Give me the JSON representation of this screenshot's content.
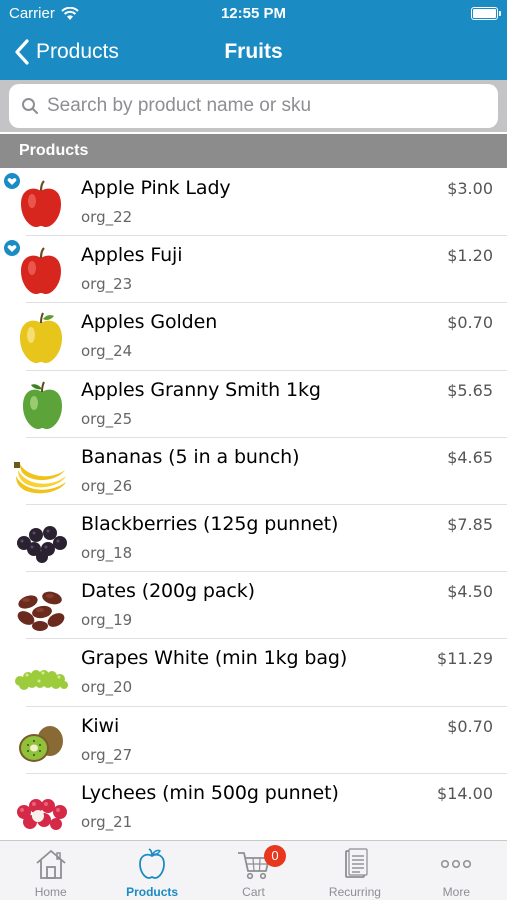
{
  "status_bar": {
    "carrier": "Carrier",
    "time": "12:55 PM"
  },
  "nav": {
    "back_label": "Products",
    "title": "Fruits"
  },
  "search": {
    "placeholder": "Search by product name or sku",
    "value": ""
  },
  "section": {
    "title": "Products"
  },
  "products": [
    {
      "name": "Apple Pink Lady",
      "sku": "org_22",
      "price": "$3.00",
      "favorite": true,
      "icon": "red-apple-icon"
    },
    {
      "name": "Apples Fuji",
      "sku": "org_23",
      "price": "$1.20",
      "favorite": true,
      "icon": "red-apple-icon"
    },
    {
      "name": "Apples Golden",
      "sku": "org_24",
      "price": "$0.70",
      "favorite": false,
      "icon": "yellow-apple-icon"
    },
    {
      "name": "Apples Granny Smith 1kg",
      "sku": "org_25",
      "price": "$5.65",
      "favorite": false,
      "icon": "green-apple-icon"
    },
    {
      "name": "Bananas (5 in a bunch)",
      "sku": "org_26",
      "price": "$4.65",
      "favorite": false,
      "icon": "banana-icon"
    },
    {
      "name": "Blackberries (125g punnet)",
      "sku": "org_18",
      "price": "$7.85",
      "favorite": false,
      "icon": "blackberries-icon"
    },
    {
      "name": "Dates (200g pack)",
      "sku": "org_19",
      "price": "$4.50",
      "favorite": false,
      "icon": "dates-icon"
    },
    {
      "name": "Grapes White (min 1kg bag)",
      "sku": "org_20",
      "price": "$11.29",
      "favorite": false,
      "icon": "grapes-icon"
    },
    {
      "name": "Kiwi",
      "sku": "org_27",
      "price": "$0.70",
      "favorite": false,
      "icon": "kiwi-icon"
    },
    {
      "name": "Lychees (min 500g punnet)",
      "sku": "org_21",
      "price": "$14.00",
      "favorite": false,
      "icon": "lychees-icon"
    }
  ],
  "tabs": [
    {
      "label": "Home",
      "icon": "home-icon",
      "active": false
    },
    {
      "label": "Products",
      "icon": "apple-icon",
      "active": true
    },
    {
      "label": "Cart",
      "icon": "cart-icon",
      "active": false,
      "badge": "0"
    },
    {
      "label": "Recurring",
      "icon": "recurring-icon",
      "active": false
    },
    {
      "label": "More",
      "icon": "more-icon",
      "active": false
    }
  ],
  "colors": {
    "brand": "#1a8bc3",
    "badge": "#e8361f",
    "section_header": "#8c8c8c"
  }
}
